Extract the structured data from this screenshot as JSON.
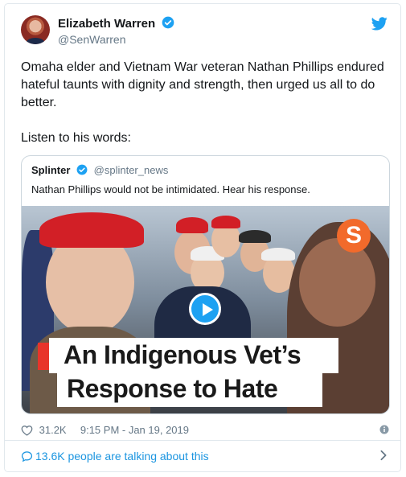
{
  "author": {
    "name": "Elizabeth Warren",
    "handle": "@SenWarren"
  },
  "tweet": {
    "text": "Omaha elder and Vietnam War veteran Nathan Phillips endured hateful taunts with dignity and strength, then urged us all to do better.\n\nListen to his words:"
  },
  "quoted": {
    "name": "Splinter",
    "handle": "@splinter_news",
    "text": "Nathan Phillips would not be intimidated. Hear his response.",
    "media": {
      "logo_letter": "S",
      "headline_line1": "An Indigenous Vet’s",
      "headline_line2": "Response to Hate"
    }
  },
  "meta": {
    "likes": "31.2K",
    "timestamp": "9:15 PM - Jan 19, 2019"
  },
  "footer": {
    "label": "13.6K people are talking about this"
  },
  "colors": {
    "accent": "#1da1f2",
    "link": "#1b95e0",
    "muted": "#657786",
    "border": "#e1e8ed",
    "brand_orange": "#f26a2b"
  },
  "icons": [
    "verified-icon",
    "twitter-bird-icon",
    "play-icon",
    "heart-icon",
    "info-icon",
    "speech-bubble-icon",
    "chevron-right-icon"
  ]
}
